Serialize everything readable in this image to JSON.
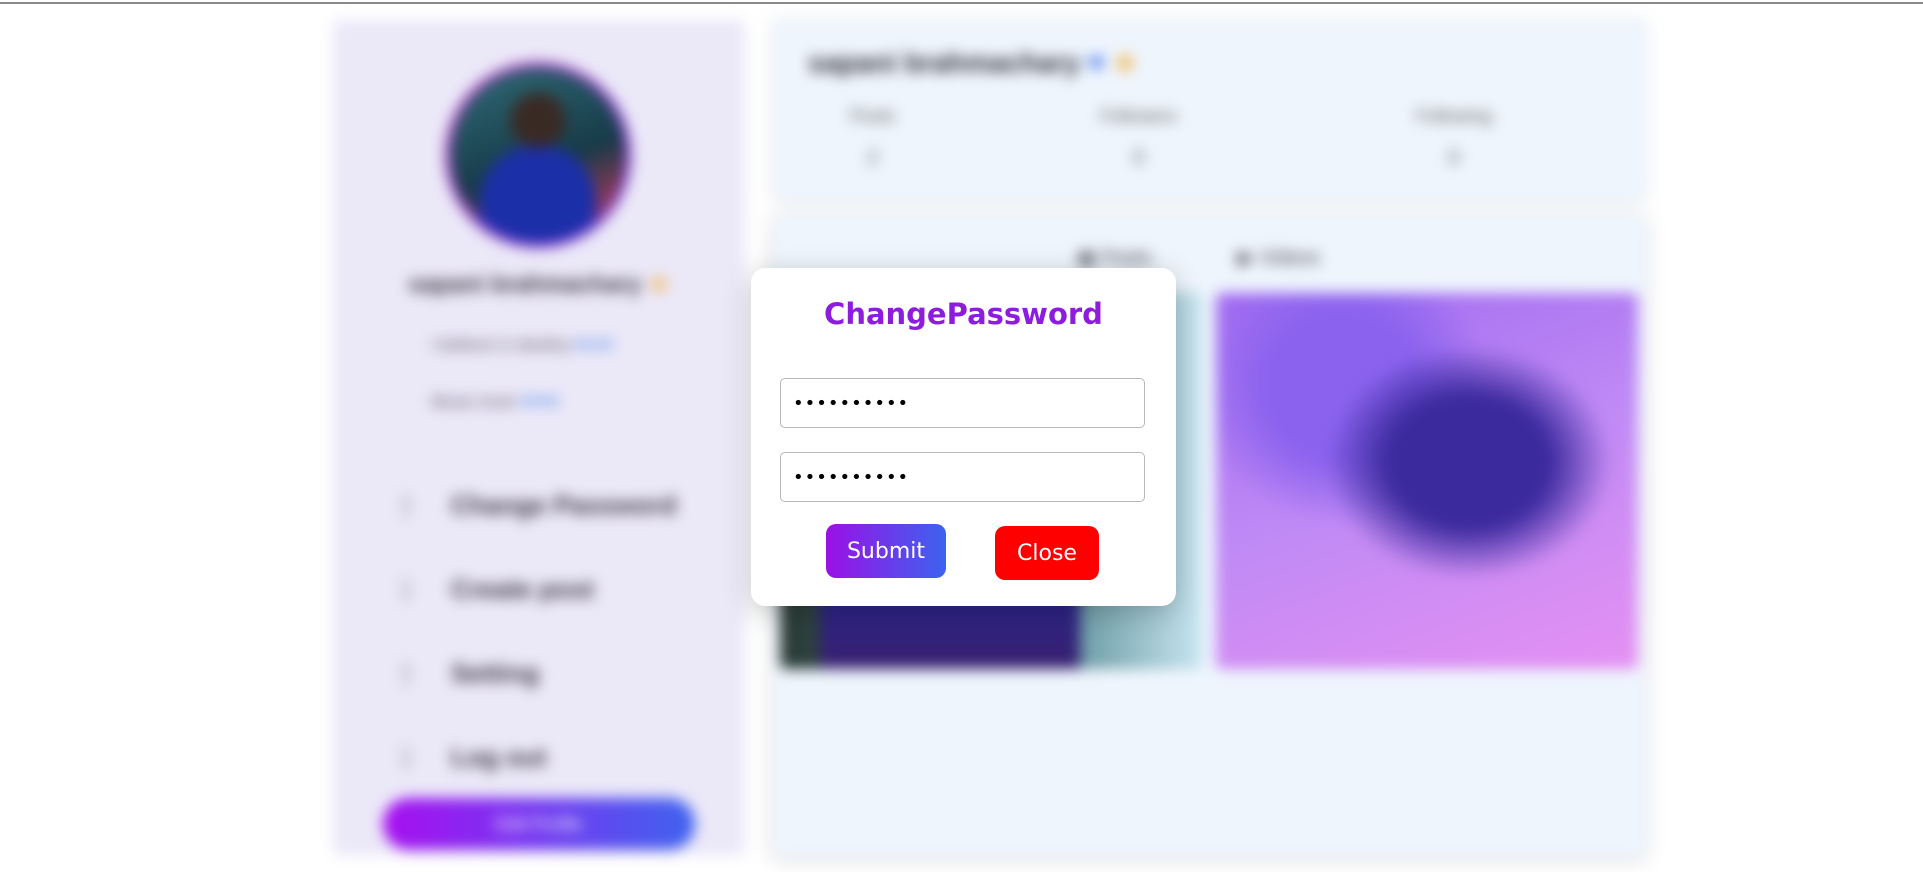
{
  "background": {
    "sidebar": {
      "username": "sapani brahmachary",
      "line1": "I believe in destiny",
      "line2": "Music lover",
      "menu": [
        "Change Password",
        "Create post",
        "Setting",
        "Log out"
      ],
      "menu_arrow": "⟩",
      "edit_button": "Edit Profile"
    },
    "profile_header": {
      "username": "sapani brahmachary",
      "stats": [
        {
          "label": "Posts",
          "value": "2"
        },
        {
          "label": "Followers",
          "value": "0"
        },
        {
          "label": "Following",
          "value": "0"
        }
      ]
    },
    "tabs": [
      "Posts",
      "Videos"
    ],
    "colors": {
      "sidebar_bg": "#ebe8f8",
      "panel_bg": "#eef5fd",
      "accent_start": "#a60ff0",
      "accent_end": "#3f63ef"
    }
  },
  "modal": {
    "title": "ChangePassword",
    "fields": [
      {
        "value": "password12",
        "type": "password"
      },
      {
        "value": "password12",
        "type": "password"
      }
    ],
    "submit_label": "Submit",
    "close_label": "Close",
    "colors": {
      "title": "#8e1cde",
      "submit_start": "#9b10e6",
      "submit_end": "#3c63ef",
      "close": "#ff0000"
    }
  }
}
